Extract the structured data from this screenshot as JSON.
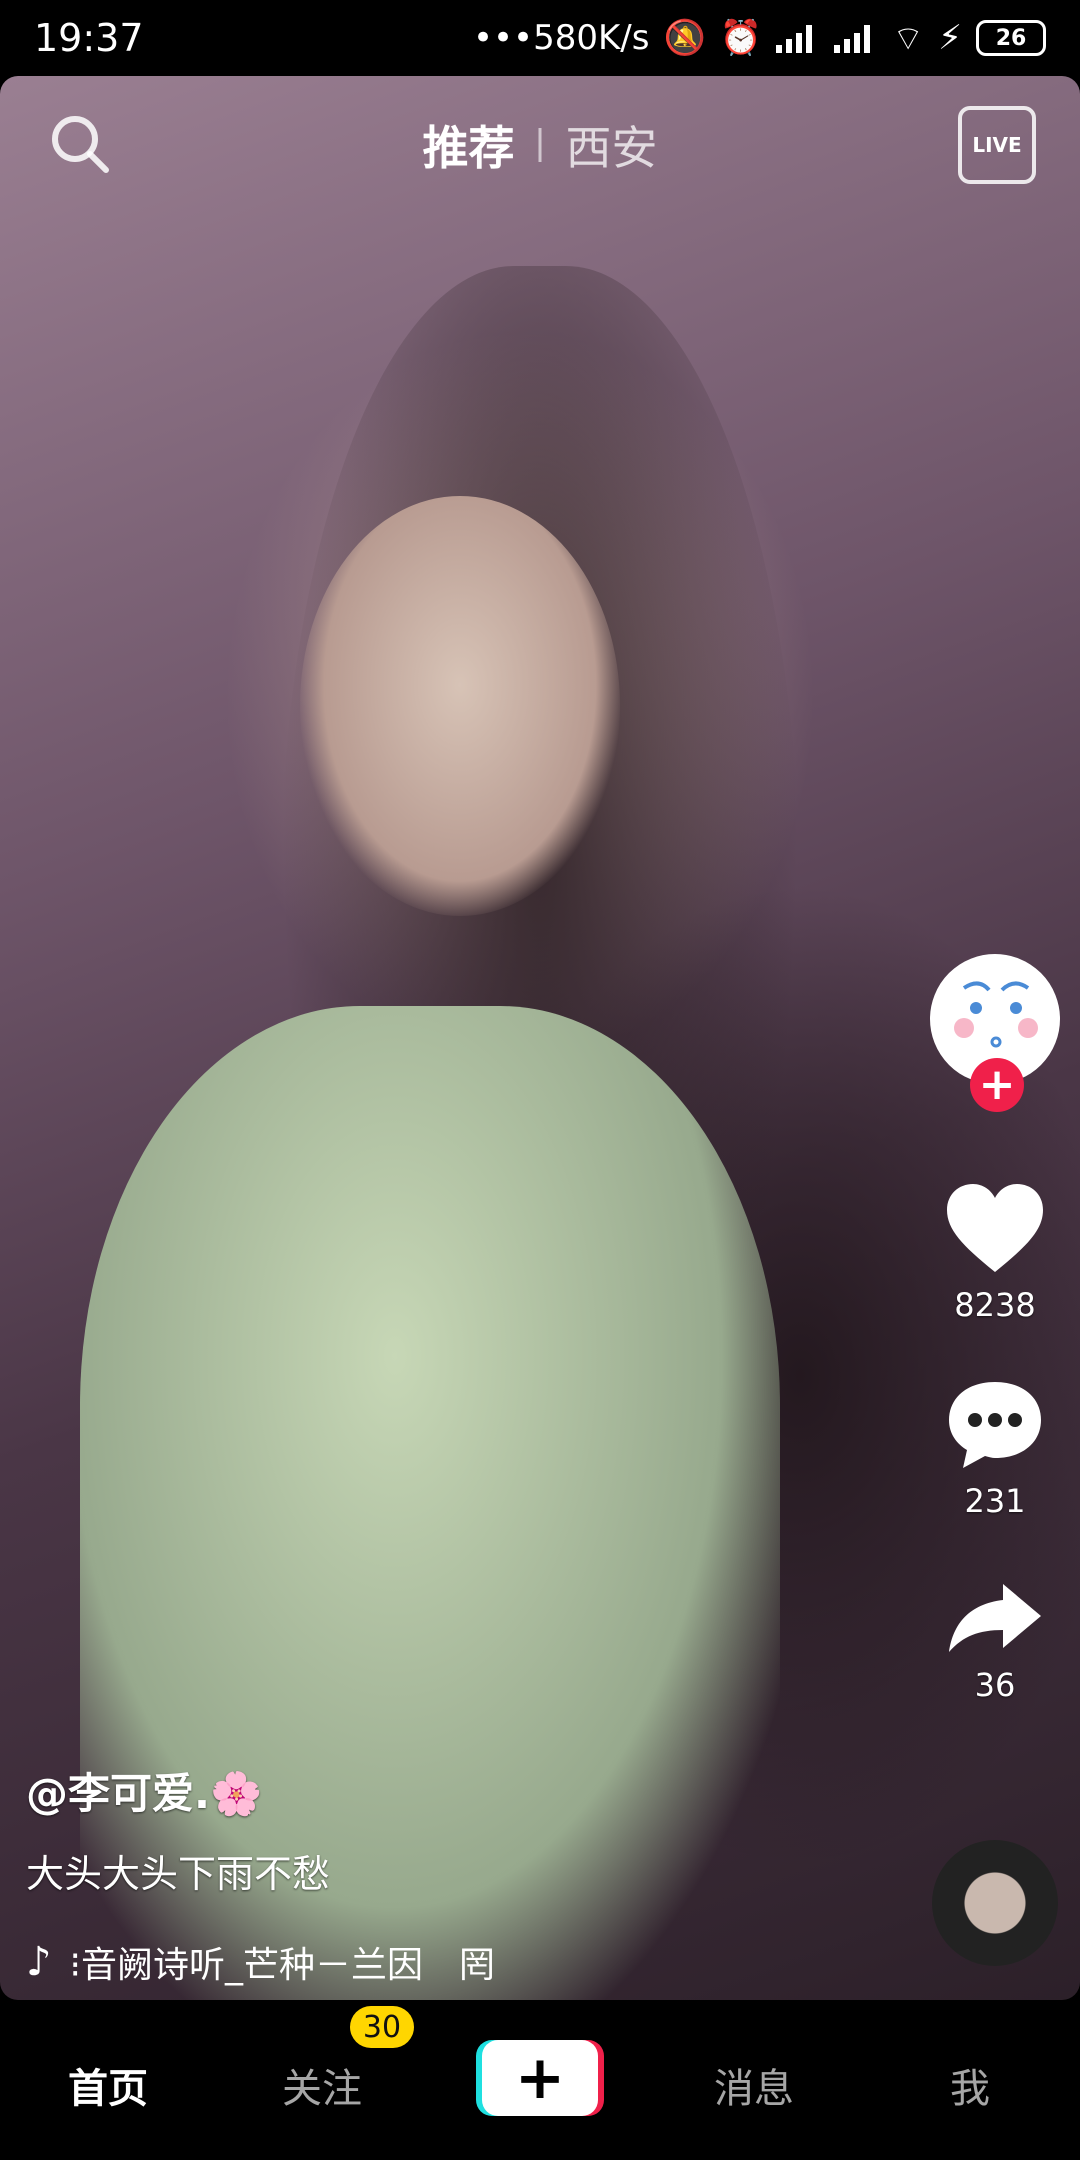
{
  "status_bar": {
    "time": "19:37",
    "net_speed": "•••580K/s",
    "battery": "26"
  },
  "top_nav": {
    "tab_recommended": "推荐",
    "tab_city": "西安",
    "live_label": "LIVE"
  },
  "rail": {
    "likes": "8238",
    "comments": "231",
    "shares": "36",
    "follow_symbol": "+"
  },
  "caption": {
    "author": "@李可爱.🌸",
    "description": "大头大头下雨不愁",
    "music": "⁝音阙诗听_芒种－兰因　罔"
  },
  "bottom_nav": {
    "home": "首页",
    "following": "关注",
    "following_badge": "30",
    "add_symbol": "+",
    "messages": "消息",
    "me": "我"
  }
}
